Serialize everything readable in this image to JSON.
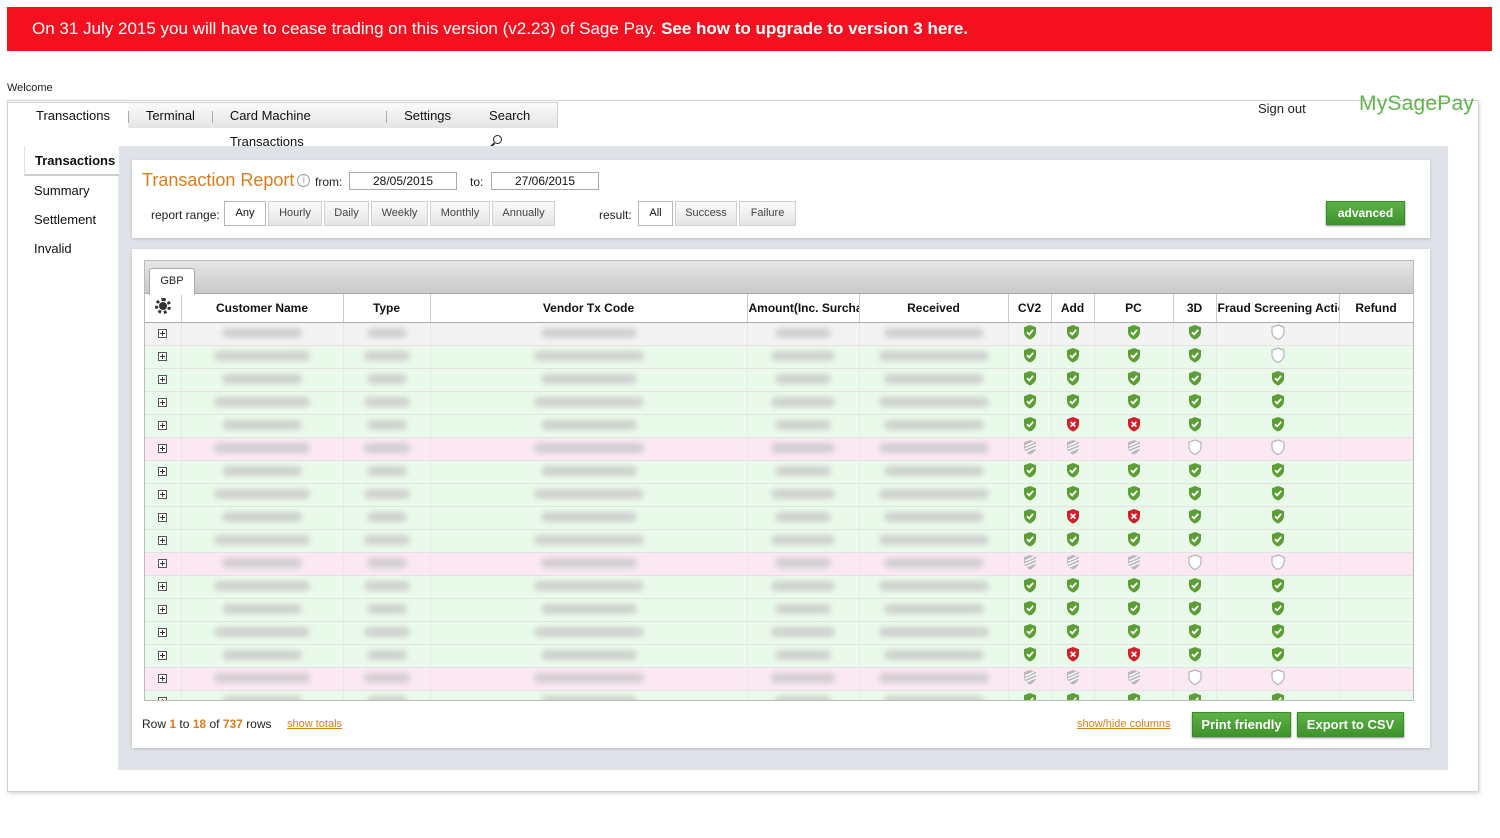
{
  "banner": {
    "text": "On 31 July 2015 you will have to cease trading on this version (v2.23) of Sage Pay.",
    "link_text": "See how to upgrade to version 3 here."
  },
  "header": {
    "welcome": "Welcome",
    "sign_out": "Sign out",
    "logo": "MySagePay"
  },
  "topnav": {
    "tabs": [
      "Transactions",
      "Terminal",
      "Card Machine Transactions",
      "Settings",
      "Search"
    ],
    "active": "Transactions"
  },
  "sidenav": {
    "items": [
      "Transactions",
      "Summary",
      "Settlement",
      "Invalid"
    ],
    "active": "Transactions"
  },
  "filters": {
    "title": "Transaction Report",
    "from_label": "from:",
    "from_value": "28/05/2015",
    "to_label": "to:",
    "to_value": "27/06/2015",
    "range_label": "report range:",
    "range_options": [
      "Any",
      "Hourly",
      "Daily",
      "Weekly",
      "Monthly",
      "Annually"
    ],
    "range_selected": "Any",
    "result_label": "result:",
    "result_options": [
      "All",
      "Success",
      "Failure"
    ],
    "result_selected": "All",
    "advanced_label": "advanced"
  },
  "grid": {
    "currency_tab": "GBP",
    "columns": [
      "Customer Name",
      "Type",
      "Vendor Tx Code",
      "Amount(Inc. Surcha",
      "Received",
      "CV2",
      "Add",
      "PC",
      "3D",
      "Fraud Screening Actio",
      "Refund"
    ],
    "rows": [
      {
        "status": "first",
        "cv2": "pass",
        "add": "pass",
        "pc": "pass",
        "d3": "pass",
        "fraud": "none"
      },
      {
        "status": "ok",
        "cv2": "pass",
        "add": "pass",
        "pc": "pass",
        "d3": "pass",
        "fraud": "none"
      },
      {
        "status": "ok",
        "cv2": "pass",
        "add": "pass",
        "pc": "pass",
        "d3": "pass",
        "fraud": "pass"
      },
      {
        "status": "ok",
        "cv2": "pass",
        "add": "pass",
        "pc": "pass",
        "d3": "pass",
        "fraud": "pass"
      },
      {
        "status": "ok",
        "cv2": "pass",
        "add": "fail",
        "pc": "fail",
        "d3": "pass",
        "fraud": "pass"
      },
      {
        "status": "fail",
        "cv2": "na",
        "add": "na",
        "pc": "na",
        "d3": "none",
        "fraud": "none"
      },
      {
        "status": "ok",
        "cv2": "pass",
        "add": "pass",
        "pc": "pass",
        "d3": "pass",
        "fraud": "pass"
      },
      {
        "status": "ok",
        "cv2": "pass",
        "add": "pass",
        "pc": "pass",
        "d3": "pass",
        "fraud": "pass"
      },
      {
        "status": "ok",
        "cv2": "pass",
        "add": "fail",
        "pc": "fail",
        "d3": "pass",
        "fraud": "pass"
      },
      {
        "status": "ok",
        "cv2": "pass",
        "add": "pass",
        "pc": "pass",
        "d3": "pass",
        "fraud": "pass"
      },
      {
        "status": "fail",
        "cv2": "na",
        "add": "na",
        "pc": "na",
        "d3": "none",
        "fraud": "none"
      },
      {
        "status": "ok",
        "cv2": "pass",
        "add": "pass",
        "pc": "pass",
        "d3": "pass",
        "fraud": "pass"
      },
      {
        "status": "ok",
        "cv2": "pass",
        "add": "pass",
        "pc": "pass",
        "d3": "pass",
        "fraud": "pass"
      },
      {
        "status": "ok",
        "cv2": "pass",
        "add": "pass",
        "pc": "pass",
        "d3": "pass",
        "fraud": "pass"
      },
      {
        "status": "ok",
        "cv2": "pass",
        "add": "fail",
        "pc": "fail",
        "d3": "pass",
        "fraud": "pass"
      },
      {
        "status": "fail",
        "cv2": "na",
        "add": "na",
        "pc": "na",
        "d3": "none",
        "fraud": "none"
      },
      {
        "status": "ok",
        "cv2": "pass",
        "add": "pass",
        "pc": "pass",
        "d3": "pass",
        "fraud": "pass"
      }
    ]
  },
  "footer": {
    "row_prefix": "Row",
    "row_from": "1",
    "to_word": "to",
    "row_to": "18",
    "of_word": "of",
    "total": "737",
    "rows_word": "rows",
    "show_totals": "show totals",
    "show_hide_columns": "show/hide columns",
    "print_friendly": "Print friendly",
    "export_csv": "Export to CSV"
  },
  "colors": {
    "banner": "#f4101e",
    "accent_orange": "#d87d1e",
    "brand_green": "#5fb54a",
    "shield_pass": "#5c9e35",
    "shield_fail": "#d0202a"
  }
}
